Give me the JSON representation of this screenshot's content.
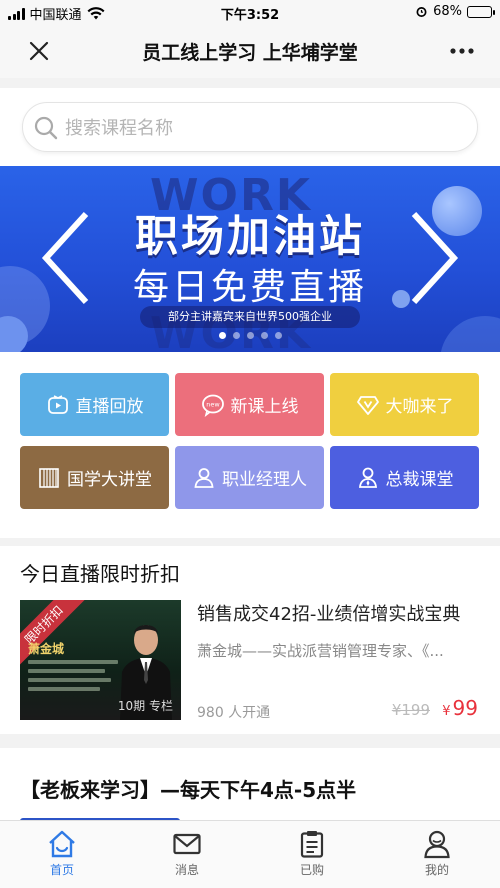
{
  "status_bar": {
    "carrier": "中国联通",
    "time": "下午3:52",
    "battery": "68%",
    "battery_level": 0.68
  },
  "nav": {
    "title": "员工线上学习 上华埔学堂"
  },
  "search": {
    "placeholder": "搜索课程名称",
    "value": ""
  },
  "banner": {
    "watermark": "WORK",
    "title": "职场加油站",
    "subtitle": "每日免费直播",
    "pill": "部分主讲嘉宾来自世界500强企业",
    "slide_count": 5,
    "active_slide": 1
  },
  "tiles": [
    {
      "label": "直播回放",
      "color": "#5aaee5",
      "icon": "play-icon"
    },
    {
      "label": "新课上线",
      "color": "#ec6f7c",
      "icon": "new-icon"
    },
    {
      "label": "大咖来了",
      "color": "#f0cf3f",
      "icon": "v-badge-icon"
    },
    {
      "label": "国学大讲堂",
      "color": "#8d6a43",
      "icon": "scroll-icon"
    },
    {
      "label": "职业经理人",
      "color": "#8f97ea",
      "icon": "person-icon"
    },
    {
      "label": "总裁课堂",
      "color": "#4d5fe0",
      "icon": "group-icon"
    }
  ],
  "section1": {
    "title": "今日直播限时折扣"
  },
  "course": {
    "thumb_ribbon": "限时折扣",
    "thumb_name": "萧金城",
    "thumb_caption": "10期 专栏",
    "title": "销售成交42招-业绩倍增实战宝典",
    "desc": "萧金城——实战派营销管理专家、《...",
    "enrolled": "980 人开通",
    "original_price": "¥199",
    "price_symbol": "¥",
    "price": "99"
  },
  "section2": {
    "title": "【老板来学习】—每天下午4点-5点半"
  },
  "tab_bar": {
    "active": "home",
    "tabs": [
      {
        "key": "home",
        "label": "首页",
        "icon": "home-icon"
      },
      {
        "key": "messages",
        "label": "消息",
        "icon": "envelope-icon"
      },
      {
        "key": "purchased",
        "label": "已购",
        "icon": "clipboard-icon"
      },
      {
        "key": "me",
        "label": "我的",
        "icon": "user-icon"
      }
    ]
  },
  "colors": {
    "accent": "#2f7ae5",
    "price": "#e8323c",
    "banner": "#2350d8"
  }
}
